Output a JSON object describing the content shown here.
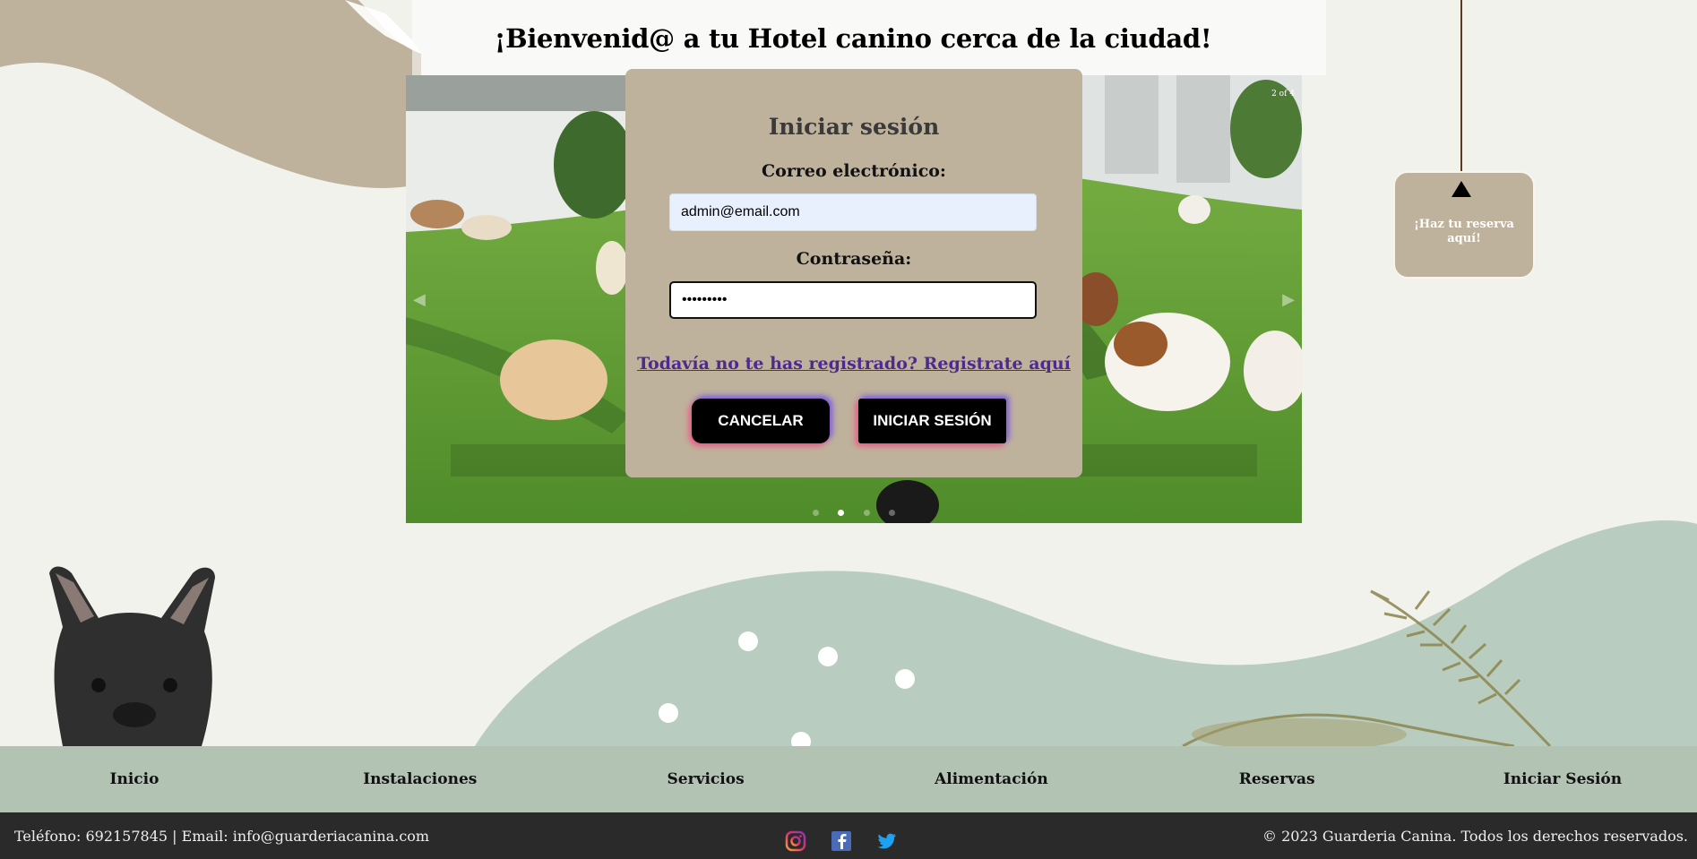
{
  "page": {
    "title": "¡Bienvenid@ a tu Hotel canino cerca de la ciudad!"
  },
  "carousel": {
    "counter": "2 of 4",
    "prev_icon": "chevron-left-icon",
    "next_icon": "chevron-right-icon",
    "slide_count": 4,
    "active_slide": 2
  },
  "login": {
    "heading": "Iniciar sesión",
    "email_label": "Correo electrónico:",
    "email_value": "admin@email.com",
    "password_label": "Contraseña:",
    "password_value": "•••••••••",
    "register_link": "Todavía no te has registrado? Registrate aquí",
    "cancel_button": "CANCELAR",
    "submit_button": "INICIAR SESIÓN"
  },
  "reserve": {
    "label": "¡Haz tu reserva aquí!"
  },
  "nav": {
    "items": [
      "Inicio",
      "Instalaciones",
      "Servicios",
      "Alimentación",
      "Reservas",
      "Iniciar Sesión"
    ]
  },
  "footer": {
    "contact": "Teléfono: 692157845 | Email: info@guarderiacanina.com",
    "copyright": "© 2023 Guarderia Canina. Todos los derechos reservados.",
    "social_icons": [
      "instagram-icon",
      "facebook-icon",
      "twitter-icon"
    ]
  },
  "colors": {
    "background": "#f2f2ed",
    "beige": "#bfb29c",
    "sage": "#b8cdbf",
    "nav": "#b2c3b4",
    "footer": "#2a2a2a",
    "link": "#4e2a8e"
  }
}
